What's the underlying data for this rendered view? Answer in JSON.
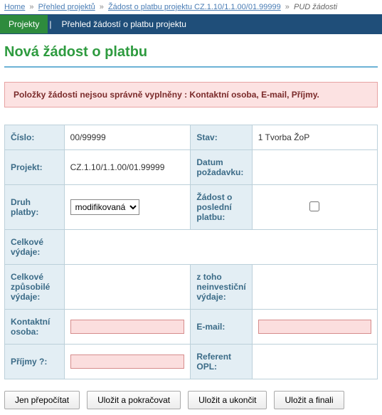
{
  "breadcrumb": {
    "items": [
      {
        "label": "Home"
      },
      {
        "label": "Přehled projektů"
      },
      {
        "label": "Žádost o platbu projektu CZ.1.10/1.1.00/01.99999"
      }
    ],
    "current": "PUD žádosti"
  },
  "tabs": {
    "projects": "Projekty",
    "overview": "Přehled žádostí o platbu projektu"
  },
  "heading": "Nová žádost o platbu",
  "error": "Položky žádosti nejsou správně vyplněny : Kontaktní osoba, E-mail, Příjmy.",
  "labels": {
    "cislo": "Číslo:",
    "stav": "Stav:",
    "projekt": "Projekt:",
    "datum_pozadavku": "Datum požadavku:",
    "druh_platby": "Druh platby:",
    "zadost_posledni": "Žádost o poslední platbu:",
    "celkove_vydaje": "Celkové výdaje:",
    "celkove_zpusobile": "Celkové způsobilé výdaje:",
    "z_toho_neinvesticni": "z toho neinvestiční výdaje:",
    "kontaktni_osoba": "Kontaktní osoba:",
    "email": "E-mail:",
    "prijmy": "Příjmy ?:",
    "referent_opl": "Referent OPL:"
  },
  "values": {
    "cislo": "00/99999",
    "stav": "1 Tvorba ŽoP",
    "projekt": "CZ.1.10/1.1.00/01.99999",
    "datum_pozadavku": "",
    "druh_platby_selected": "modifikovaná",
    "zadost_posledni_checked": false,
    "celkove_vydaje": "",
    "celkove_zpusobile": "",
    "z_toho_neinvesticni": "",
    "kontaktni_osoba": "",
    "email": "",
    "prijmy": "",
    "referent_opl": ""
  },
  "buttons": {
    "recalc": "Jen přepočítat",
    "save_continue": "Uložit a pokračovat",
    "save_close": "Uložit a ukončit",
    "save_finalize": "Uložit a finali"
  }
}
